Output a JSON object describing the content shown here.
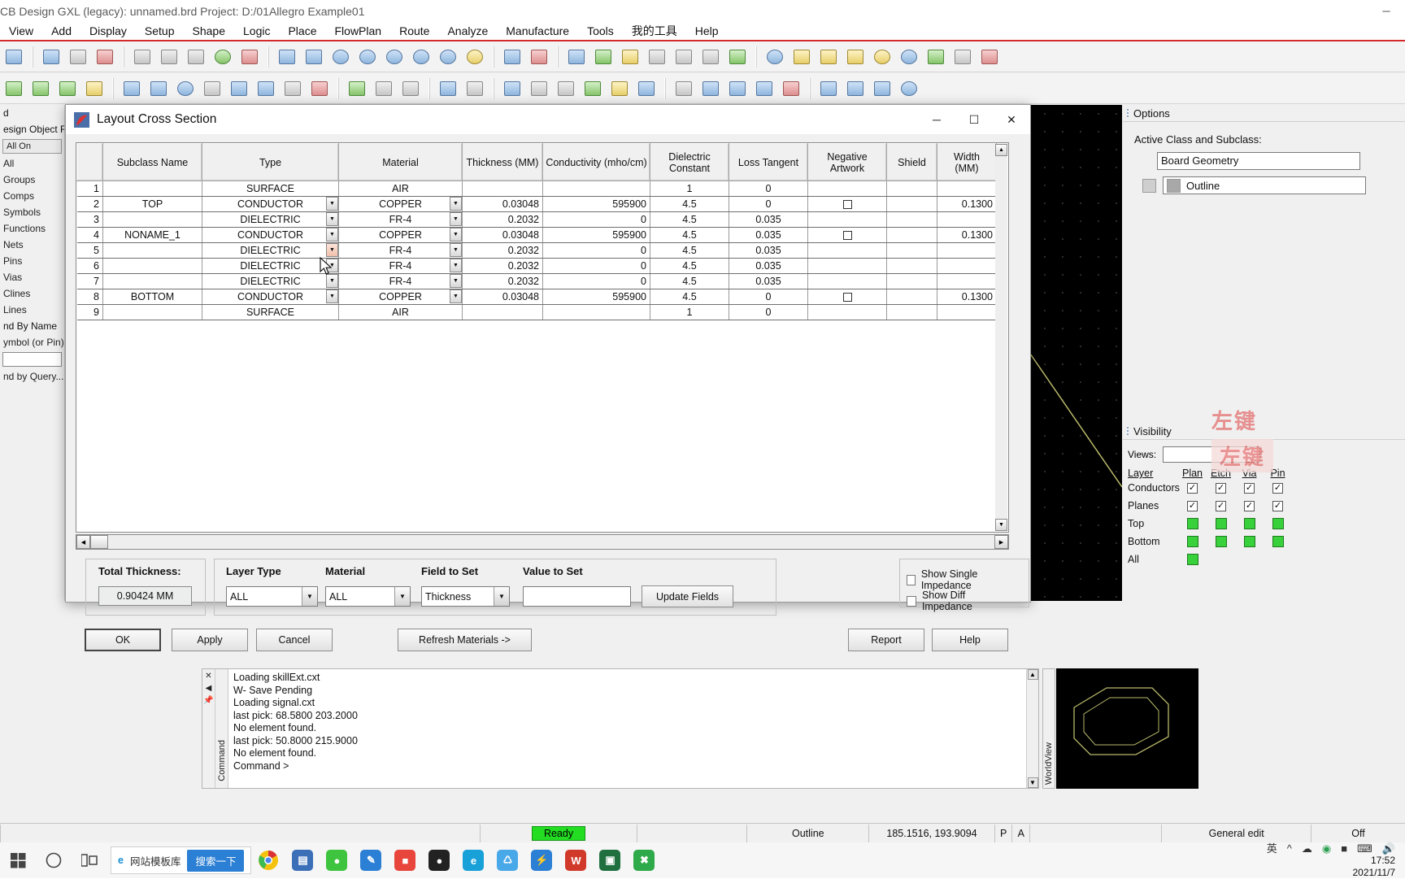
{
  "app": {
    "title": "CB Design GXL (legacy): unnamed.brd  Project: D:/01Allegro Example01",
    "win_min": "─",
    "win_max": "☐",
    "win_close": "✕",
    "menus": [
      {
        "label": "View"
      },
      {
        "label": "Add"
      },
      {
        "label": "Display"
      },
      {
        "label": "Setup"
      },
      {
        "label": "Shape"
      },
      {
        "label": "Logic"
      },
      {
        "label": "Place"
      },
      {
        "label": "FlowPlan"
      },
      {
        "label": "Route"
      },
      {
        "label": "Analyze"
      },
      {
        "label": "Manufacture"
      },
      {
        "label": "Tools"
      },
      {
        "label": "我的工具"
      },
      {
        "label": "Help"
      }
    ]
  },
  "left_dock": {
    "items": [
      {
        "label": "d"
      },
      {
        "label": "esign Object Fi"
      },
      {
        "label": "All On"
      },
      {
        "label": "All"
      },
      {
        "label": "Groups"
      },
      {
        "label": "Comps"
      },
      {
        "label": "Symbols"
      },
      {
        "label": "Functions"
      },
      {
        "label": "Nets"
      },
      {
        "label": "Pins"
      },
      {
        "label": "Vias"
      },
      {
        "label": "Clines"
      },
      {
        "label": "Lines"
      },
      {
        "label": "nd By Name"
      },
      {
        "label": "ymbol (or Pin)"
      },
      {
        "label": "nd by Query..."
      }
    ]
  },
  "options_panel": {
    "title": "Options",
    "active_class_label": "Active Class and Subclass:",
    "class_value": "Board Geometry",
    "subclass_value": "Outline"
  },
  "visibility_panel": {
    "title": "Visibility",
    "views_label": "Views:",
    "views_value": "",
    "columns": [
      "Layer",
      "Plan",
      "Etch",
      "Via",
      "Pin"
    ],
    "rows": [
      {
        "name": "Conductors",
        "checks": [
          true,
          true,
          true,
          true
        ]
      },
      {
        "name": "Planes",
        "checks": [
          true,
          true,
          true,
          true
        ]
      }
    ],
    "layer_rows": [
      {
        "name": "Top",
        "swatches": 4
      },
      {
        "name": "Bottom",
        "swatches": 4
      },
      {
        "name": "All",
        "swatches": 1
      }
    ],
    "watermark1": "左键",
    "watermark2": "左键"
  },
  "dialog": {
    "title": "Layout Cross Section",
    "minimize": "─",
    "maximize": "☐",
    "close": "✕",
    "columns": [
      {
        "key": "idx",
        "label": ""
      },
      {
        "key": "subclass",
        "label": "Subclass Name"
      },
      {
        "key": "type",
        "label": "Type"
      },
      {
        "key": "material",
        "label": "Material"
      },
      {
        "key": "thickness",
        "label": "Thickness (MM)"
      },
      {
        "key": "conductivity",
        "label": "Conductivity (mho/cm)"
      },
      {
        "key": "dielectric",
        "label": "Dielectric\nConstant"
      },
      {
        "key": "loss",
        "label": "Loss Tangent"
      },
      {
        "key": "negative",
        "label": "Negative\nArtwork"
      },
      {
        "key": "shield",
        "label": "Shield"
      },
      {
        "key": "width",
        "label": "Width\n(MM)"
      }
    ],
    "rows": [
      {
        "idx": "1",
        "subclass": "",
        "type": "SURFACE",
        "type_style": "surf",
        "type_dd": false,
        "material": "AIR",
        "material_dd": false,
        "thickness": "",
        "conductivity": "",
        "dielectric": "1",
        "loss": "0",
        "negative": "",
        "shield": "",
        "width": "",
        "shaded": true
      },
      {
        "idx": "2",
        "subclass": "TOP",
        "type": "CONDUCTOR",
        "type_style": "cond",
        "type_dd": true,
        "material": "COPPER",
        "material_dd": true,
        "thickness": "0.03048",
        "conductivity": "595900",
        "dielectric": "4.5",
        "loss": "0",
        "negative": "checkbox",
        "shield": "",
        "width": "0.1300",
        "shaded": false
      },
      {
        "idx": "3",
        "subclass": "",
        "type": "DIELECTRIC",
        "type_style": "diel",
        "type_dd": true,
        "material": "FR-4",
        "material_dd": true,
        "thickness": "0.2032",
        "conductivity": "0",
        "dielectric": "4.5",
        "loss": "0.035",
        "negative": "",
        "shield": "",
        "width": "",
        "shaded": true
      },
      {
        "idx": "4",
        "subclass": "NONAME_1",
        "type": "CONDUCTOR",
        "type_style": "cond",
        "type_dd": true,
        "material": "COPPER",
        "material_dd": true,
        "thickness": "0.03048",
        "conductivity": "595900",
        "dielectric": "4.5",
        "loss": "0.035",
        "negative": "checkbox",
        "shield": "",
        "width": "0.1300",
        "shaded": false
      },
      {
        "idx": "5",
        "subclass": "",
        "type": "DIELECTRIC",
        "type_style": "diel",
        "type_dd": true,
        "type_dd_hl": true,
        "material": "FR-4",
        "material_dd": true,
        "thickness": "0.2032",
        "conductivity": "0",
        "dielectric": "4.5",
        "loss": "0.035",
        "negative": "",
        "shield": "",
        "width": "",
        "shaded": true
      },
      {
        "idx": "6",
        "subclass": "",
        "type": "DIELECTRIC",
        "type_style": "diel",
        "type_dd": true,
        "material": "FR-4",
        "material_dd": true,
        "thickness": "0.2032",
        "conductivity": "0",
        "dielectric": "4.5",
        "loss": "0.035",
        "negative": "",
        "shield": "",
        "width": "",
        "shaded": true
      },
      {
        "idx": "7",
        "subclass": "",
        "type": "DIELECTRIC",
        "type_style": "diel",
        "type_dd": true,
        "material": "FR-4",
        "material_dd": true,
        "thickness": "0.2032",
        "conductivity": "0",
        "dielectric": "4.5",
        "loss": "0.035",
        "negative": "",
        "shield": "",
        "width": "",
        "shaded": true
      },
      {
        "idx": "8",
        "subclass": "BOTTOM",
        "type": "CONDUCTOR",
        "type_style": "cond",
        "type_dd": true,
        "material": "COPPER",
        "material_dd": true,
        "thickness": "0.03048",
        "conductivity": "595900",
        "dielectric": "4.5",
        "loss": "0",
        "negative": "checkbox",
        "shield": "",
        "width": "0.1300",
        "shaded": false
      },
      {
        "idx": "9",
        "subclass": "",
        "type": "SURFACE",
        "type_style": "surf",
        "type_dd": false,
        "material": "AIR",
        "material_dd": false,
        "thickness": "",
        "conductivity": "",
        "dielectric": "1",
        "loss": "0",
        "negative": "",
        "shield": "",
        "width": "",
        "shaded": true
      }
    ],
    "total_thickness_label": "Total Thickness:",
    "total_thickness_value": "0.90424 MM",
    "layer_type_label": "Layer Type",
    "layer_type_value": "ALL",
    "material_label": "Material",
    "material_value": "ALL",
    "field_to_set_label": "Field to Set",
    "field_to_set_value": "Thickness",
    "value_to_set_label": "Value to Set",
    "value_to_set_value": "",
    "update_fields_label": "Update Fields",
    "show_single_impedance": "Show Single Impedance",
    "show_diff_impedance": "Show Diff Impedance",
    "buttons": {
      "ok": "OK",
      "apply": "Apply",
      "cancel": "Cancel",
      "refresh": "Refresh Materials ->",
      "report": "Report",
      "help": "Help"
    }
  },
  "console": {
    "tab_label": "Command",
    "lines": [
      "Loading skillExt.cxt",
      "W- Save Pending",
      "",
      "Loading signal.cxt",
      "last pick:  68.5800 203.2000",
      "No element found.",
      "last pick:  50.8000 215.9000",
      "No element found.",
      "",
      "Command >"
    ],
    "worldview_label": "WorldView"
  },
  "status_bar": {
    "ready": "Ready",
    "subclass": "Outline",
    "coords": "185.1516, 193.9094",
    "p_flag": "P",
    "a_flag": "A",
    "mode": "General edit",
    "off": "Off"
  },
  "taskbar": {
    "app_label": "网站模板库",
    "search_pill": "搜索一下",
    "clock_time": "17:52",
    "clock_date": "2021/11/7",
    "ime": "英"
  }
}
